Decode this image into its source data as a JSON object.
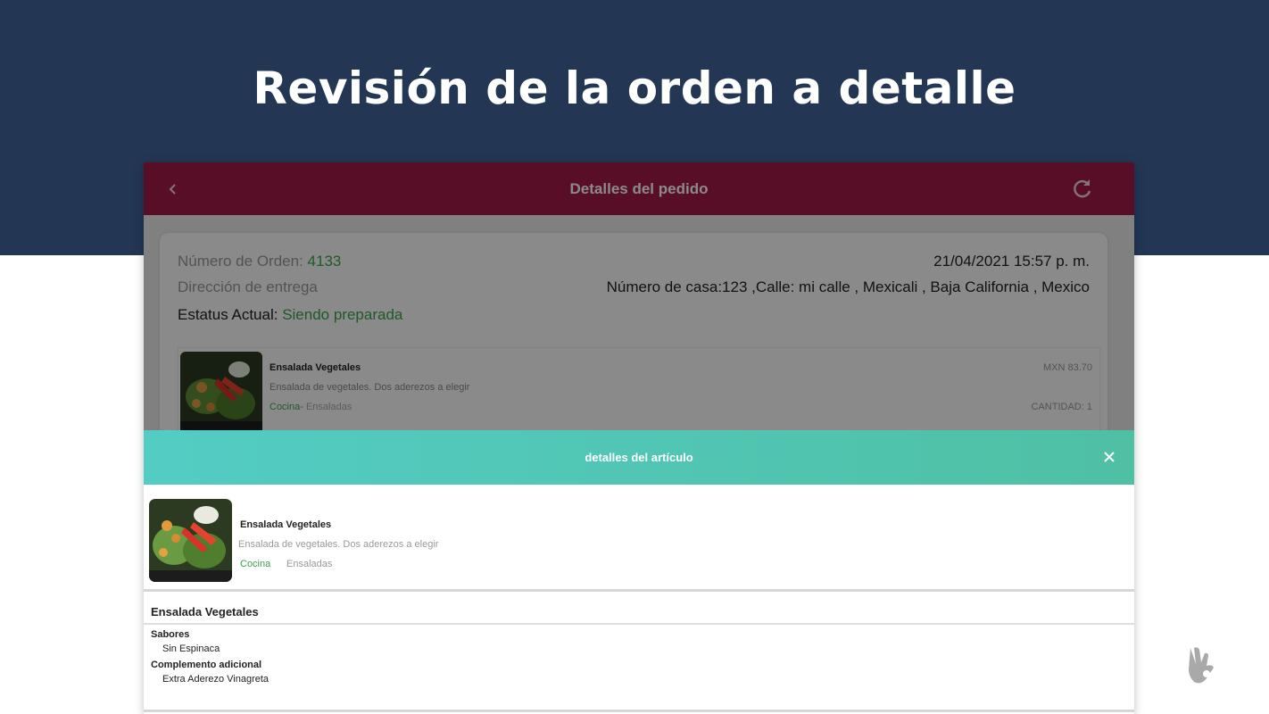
{
  "slide": {
    "title": "Revisión de la orden a detalle"
  },
  "appbar": {
    "title": "Detalles del pedido",
    "back_icon": "chevron-left-icon",
    "refresh_icon": "refresh-icon"
  },
  "order": {
    "number_label": "Número de Orden:",
    "number_value": "4133",
    "datetime": "21/04/2021 15:57 p. m.",
    "address_label": "Dirección de entrega",
    "address_value": "Número de casa:123 ,Calle: mi calle , Mexicali , Baja California , Mexico",
    "status_label": "Estatus Actual:",
    "status_value": "Siendo preparada",
    "item": {
      "name": "Ensalada Vegetales",
      "description": "Ensalada de vegetales. Dos aderezos a elegir",
      "kitchen": "Cocina-",
      "category": "Ensaladas",
      "price": "MXN 83.70",
      "quantity": "CANTIDAD: 1"
    }
  },
  "modal": {
    "title": "detalles del artículo",
    "close_icon": "close-icon",
    "item": {
      "name": "Ensalada Vegetales",
      "description": "Ensalada de vegetales. Dos aderezos a elegir",
      "kitchen": "Cocina",
      "category": "Ensaladas"
    },
    "section_title": "Ensalada Vegetales",
    "groups": [
      {
        "name": "Sabores",
        "option": "Sin Espinaca"
      },
      {
        "name": "Complemento adicional",
        "option": "Extra Aderezo Vinagreta"
      }
    ]
  },
  "colors": {
    "band": "#233754",
    "appbar": "#a51a4a",
    "accent_green": "#3aa64a",
    "modal_header": "#53ccc4"
  },
  "logo_icon": "hand-gesture-icon"
}
